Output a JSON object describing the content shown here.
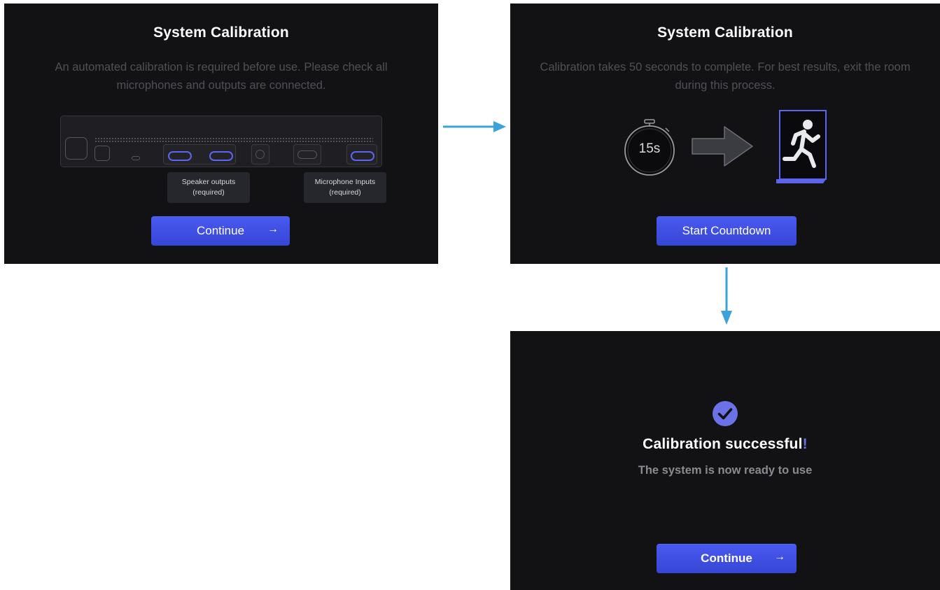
{
  "screen1": {
    "title": "System Calibration",
    "description": "An automated calibration is required before use. Please check all microphones and outputs are connected.",
    "speaker_label": "Speaker outputs",
    "speaker_note": "(required)",
    "mic_label": "Microphone Inputs",
    "mic_note": "(required)",
    "button_label": "Continue",
    "button_icon": "→"
  },
  "screen2": {
    "title": "System Calibration",
    "description": "Calibration takes 50 seconds to complete. For best results, exit the room during this process.",
    "timer_label": "15s",
    "button_label": "Start Countdown"
  },
  "screen3": {
    "title": "Calibration successful",
    "title_mark": "!",
    "subtitle": "The system is now ready to use",
    "button_label": "Continue",
    "button_icon": "→"
  },
  "colors": {
    "panel_bg": "#121214",
    "accent": "#4a59f0",
    "flow_arrow": "#3aa3d9",
    "check": "#6b72e8"
  },
  "icons": {
    "device": "audio-device-icon",
    "stopwatch": "stopwatch-icon",
    "arrow": "right-arrow-icon",
    "exit": "exit-door-running-person-icon",
    "check": "checkmark-circle-icon"
  }
}
